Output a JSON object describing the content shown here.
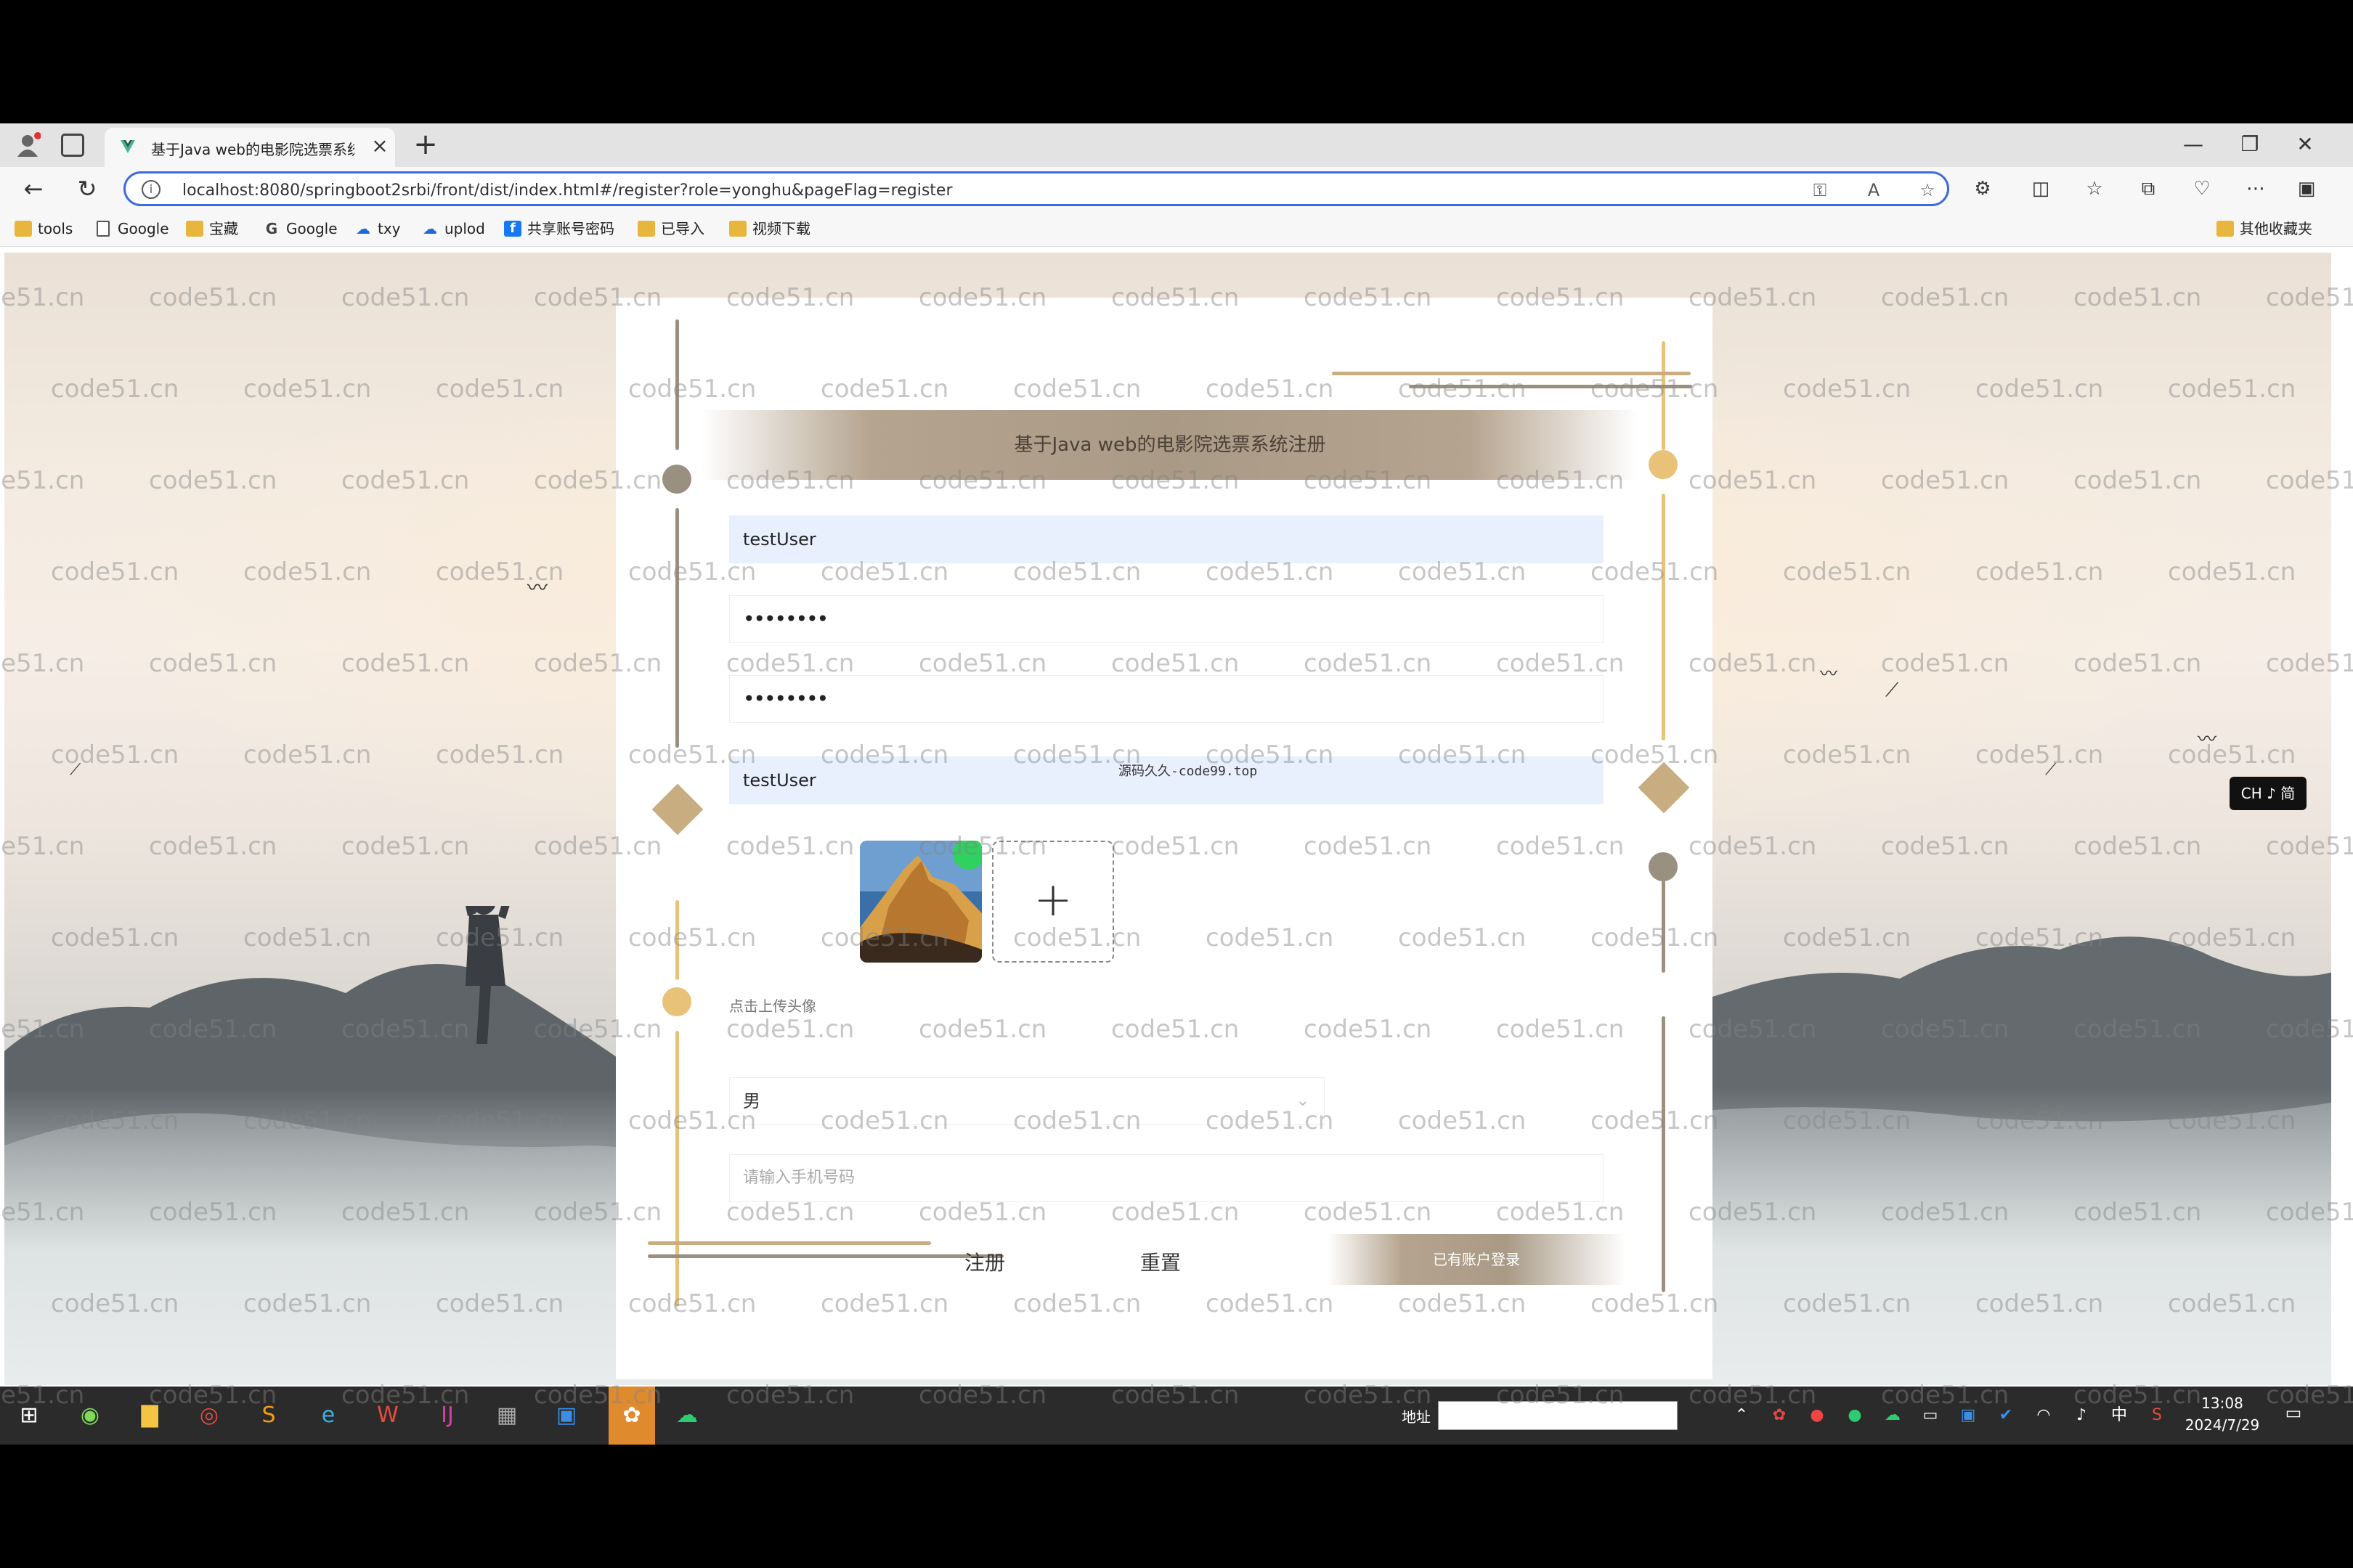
{
  "browser": {
    "tab_title": "基于Java web的电影院选票系统",
    "tab_close": "×",
    "new_tab": "+",
    "url": "localhost:8080/springboot2srbi/front/dist/index.html#/register?role=yonghu&pageFlag=register",
    "window_controls": {
      "minimize": "—",
      "restore": "❐",
      "close": "✕"
    }
  },
  "bookmarks": {
    "items": [
      {
        "label": "tools",
        "icon": "folder-icon"
      },
      {
        "label": "Google",
        "icon": "page-icon"
      },
      {
        "label": "宝藏",
        "icon": "folder-icon"
      },
      {
        "label": "Google",
        "icon": "google-icon"
      },
      {
        "label": "txy",
        "icon": "cloud-icon"
      },
      {
        "label": "uplod",
        "icon": "cloud-icon"
      },
      {
        "label": "共享账号密码",
        "icon": "facebook-icon"
      },
      {
        "label": "已导入",
        "icon": "folder-icon"
      },
      {
        "label": "视频下载",
        "icon": "folder-icon"
      }
    ],
    "other": "其他收藏夹"
  },
  "watermark": "code51.cn",
  "form": {
    "title": "基于Java web的电影院选票系统注册",
    "account_value": "testUser",
    "password_value": "••••••••",
    "confirm_password_value": "••••••••",
    "name_value": "testUser",
    "source_note": "源码久久-code99.top",
    "upload_plus": "+",
    "upload_hint": "点击上传头像",
    "gender_value": "男",
    "gender_arrow": "⌄",
    "phone_placeholder": "请输入手机号码",
    "register_button": "注册",
    "reset_button": "重置",
    "login_button": "已有账户登录"
  },
  "ime": "CH ♪ 简",
  "taskbar": {
    "address_label": "地址",
    "time": "13:08",
    "date": "2024/7/29",
    "ime_zh": "中"
  },
  "colors": {
    "accent_gold": "#e9c27a",
    "accent_taupe": "#b5a48f",
    "url_focus": "#3d6ae0"
  }
}
